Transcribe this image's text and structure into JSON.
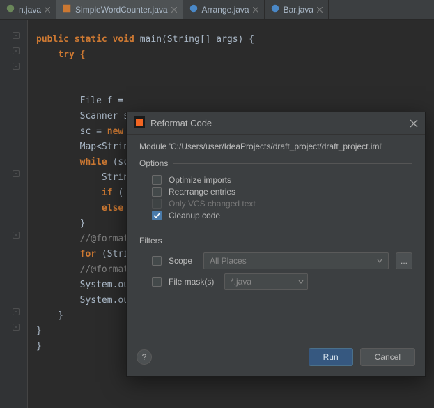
{
  "tabs": [
    {
      "label": "n.java"
    },
    {
      "label": "SimpleWordCounter.java"
    },
    {
      "label": "Arrange.java"
    },
    {
      "label": "Bar.java"
    }
  ],
  "code": {
    "line1_pre": "public static void ",
    "line1_main": "main",
    "line1_post": "(String[] args) {",
    "line2": "    try {",
    "line3": "",
    "line4": "",
    "line5": "        File f =",
    "line6": "        Scanner s",
    "line7_pre": "        sc = ",
    "line7_new": "new",
    "line8": "        Map<Strin",
    "line9_pre": "        ",
    "line9_while": "while",
    "line9_post": " (sc",
    "line10": "            Strin",
    "line11_pre": "            ",
    "line11_if": "if",
    "line11_post": " (",
    "line12_pre": "            ",
    "line12_else": "else",
    "line13": "        }",
    "line14_pre": "        ",
    "line14_cm": "//@format",
    "line15_pre": "        ",
    "line15_for": "for",
    "line15_post": " (Stri",
    "line16_pre": "        ",
    "line16_cm": "//@format",
    "line17": "        System.ou",
    "line18": "        System.ou",
    "line19": "    }",
    "line20": "}",
    "line21": "}"
  },
  "dialog": {
    "title": "Reformat Code",
    "module_text": "Module 'C:/Users/user/IdeaProjects/draft_project/draft_project.iml'",
    "options_label": "Options",
    "optimize": "Optimize imports",
    "rearrange": "Rearrange entries",
    "vcs": "Only VCS changed text",
    "cleanup": "Cleanup code",
    "filters_label": "Filters",
    "scope_label": "Scope",
    "scope_value": "All Places",
    "ellipsis": "...",
    "mask_label": "File mask(s)",
    "mask_value": "*.java",
    "help": "?",
    "run": "Run",
    "cancel": "Cancel"
  }
}
